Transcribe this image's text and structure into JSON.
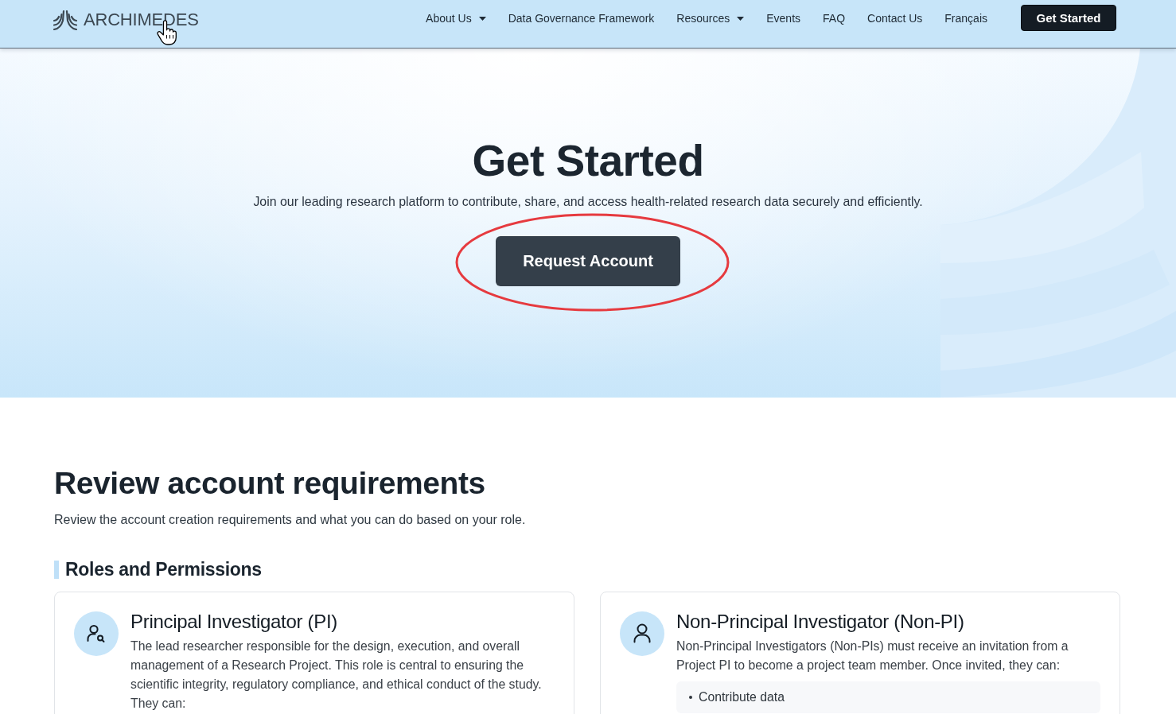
{
  "header": {
    "logo": {
      "text": "ARCHIMEDES",
      "hovered": true
    },
    "nav": [
      {
        "label": "About Us",
        "dropdown": true
      },
      {
        "label": "Data Governance Framework",
        "dropdown": false
      },
      {
        "label": "Resources",
        "dropdown": true
      },
      {
        "label": "Events",
        "dropdown": false
      },
      {
        "label": "FAQ",
        "dropdown": false
      },
      {
        "label": "Contact Us",
        "dropdown": false
      },
      {
        "label": "Français",
        "dropdown": false
      }
    ],
    "cta": "Get Started"
  },
  "hero": {
    "title": "Get Started",
    "subtitle": "Join our leading research platform to contribute, share, and access health-related research data securely and efficiently.",
    "button": {
      "label": "Request Account",
      "circled": true
    }
  },
  "requirements": {
    "title": "Review account requirements",
    "subtitle": "Review the account creation requirements and what you can do based on your role.",
    "roles_heading": "Roles and Permissions",
    "roles": [
      {
        "title": "Principal Investigator (PI)",
        "description": "The lead researcher responsible for the design, execution, and overall management of a Research Project. This role is central to ensuring the scientific integrity, regulatory compliance, and ethical conduct of the study. They can:"
      },
      {
        "title": "Non-Principal Investigator (Non-PI)",
        "description": "Non-Principal Investigators (Non-PIs) must receive an invitation from a Project PI to become a project team member. Once invited, they can:",
        "abilities": [
          "Contribute data"
        ]
      }
    ]
  }
}
